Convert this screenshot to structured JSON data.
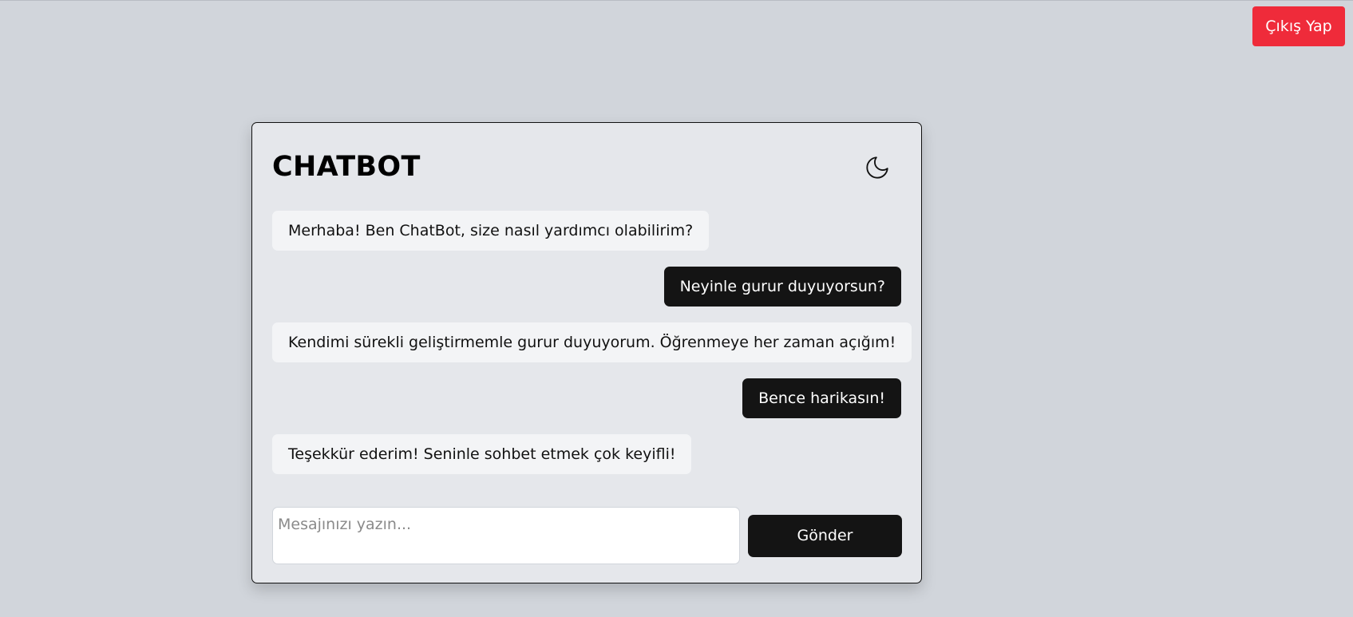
{
  "header": {
    "logout_label": "Çıkış Yap"
  },
  "chat": {
    "title": "CHATBOT",
    "theme_toggle_icon": "moon-icon",
    "messages": [
      {
        "role": "bot",
        "text": "Merhaba! Ben ChatBot, size nasıl yardımcı olabilirim?"
      },
      {
        "role": "user",
        "text": "Neyinle gurur duyuyorsun?"
      },
      {
        "role": "bot",
        "text": "Kendimi sürekli geliştirmemle gurur duyuyorum. Öğrenmeye her zaman açığım!"
      },
      {
        "role": "user",
        "text": "Bence harikasın!"
      },
      {
        "role": "bot",
        "text": "Teşekkür ederim! Seninle sohbet etmek çok keyifli!"
      }
    ],
    "input": {
      "value": "",
      "placeholder": "Mesajınızı yazın..."
    },
    "send_label": "Gönder"
  },
  "colors": {
    "page_background": "#d1d5db",
    "card_background": "#e5e7eb",
    "logout_button": "#ef2b3a",
    "user_bubble": "#141414",
    "bot_bubble": "#f3f4f6"
  }
}
